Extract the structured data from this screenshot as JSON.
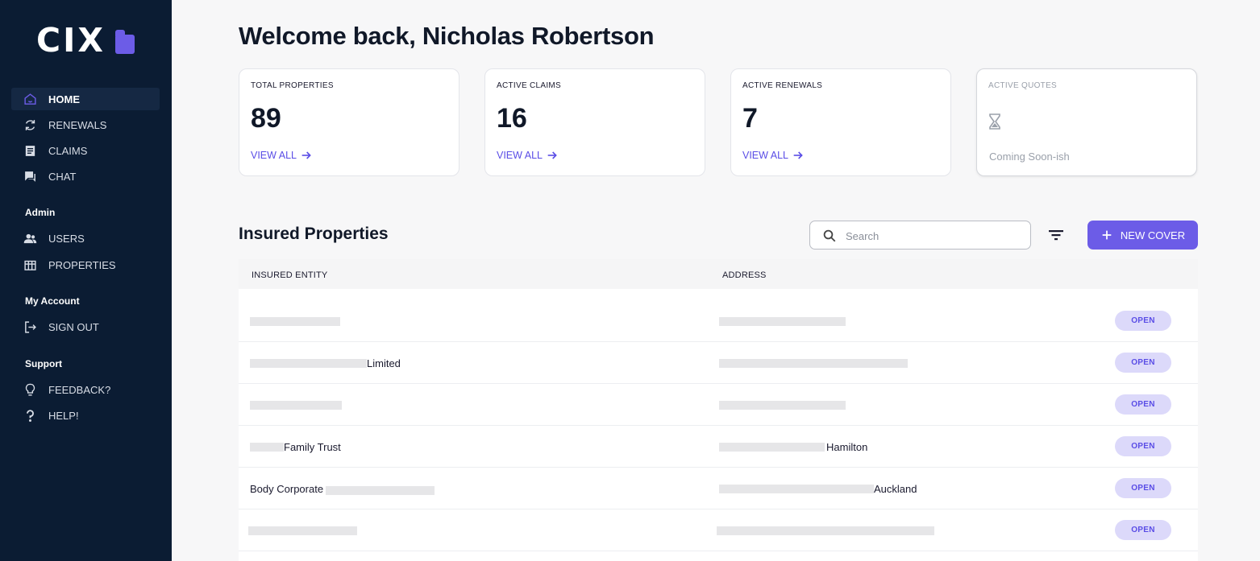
{
  "sidebar": {
    "logo": "CIX",
    "nav": [
      {
        "label": "HOME",
        "icon": "home-icon"
      },
      {
        "label": "RENEWALS",
        "icon": "refresh-icon"
      },
      {
        "label": "CLAIMS",
        "icon": "document-icon"
      },
      {
        "label": "CHAT",
        "icon": "chat-icon"
      }
    ],
    "admin_title": "Admin",
    "admin": [
      {
        "label": "USERS",
        "icon": "users-icon"
      },
      {
        "label": "PROPERTIES",
        "icon": "building-icon"
      }
    ],
    "account_title": "My Account",
    "account": [
      {
        "label": "SIGN OUT",
        "icon": "logout-icon"
      }
    ],
    "support_title": "Support",
    "support": [
      {
        "label": "FEEDBACK?",
        "icon": "lightbulb-icon"
      },
      {
        "label": "HELP!",
        "icon": "question-icon"
      }
    ]
  },
  "header": {
    "welcome": "Welcome back, Nicholas Robertson"
  },
  "cards": [
    {
      "label": "TOTAL PROPERTIES",
      "value": "89",
      "link": "VIEW ALL"
    },
    {
      "label": "ACTIVE CLAIMS",
      "value": "16",
      "link": "VIEW ALL"
    },
    {
      "label": "ACTIVE RENEWALS",
      "value": "7",
      "link": "VIEW ALL"
    },
    {
      "label": "ACTIVE QUOTES",
      "note": "Coming Soon-ish",
      "icon": "hourglass-icon"
    }
  ],
  "properties": {
    "title": "Insured Properties",
    "search_placeholder": "Search",
    "new_cover_label": "NEW COVER",
    "columns": [
      "INSURED ENTITY",
      "ADDRESS"
    ],
    "rows": [
      {
        "entity": "",
        "address": "",
        "status": "OPEN"
      },
      {
        "entity": "Limited",
        "address": "",
        "status": "OPEN"
      },
      {
        "entity": "",
        "address": "",
        "status": "OPEN"
      },
      {
        "entity": "Family Trust",
        "address": "Hamilton",
        "status": "OPEN"
      },
      {
        "entity": "Body Corporate",
        "address": "Auckland",
        "status": "OPEN"
      },
      {
        "entity": "",
        "address": "",
        "status": "OPEN"
      }
    ]
  },
  "colors": {
    "sidebar_bg": "#0b1c33",
    "accent": "#6c5ce7",
    "badge_bg": "#dcd9fa"
  }
}
